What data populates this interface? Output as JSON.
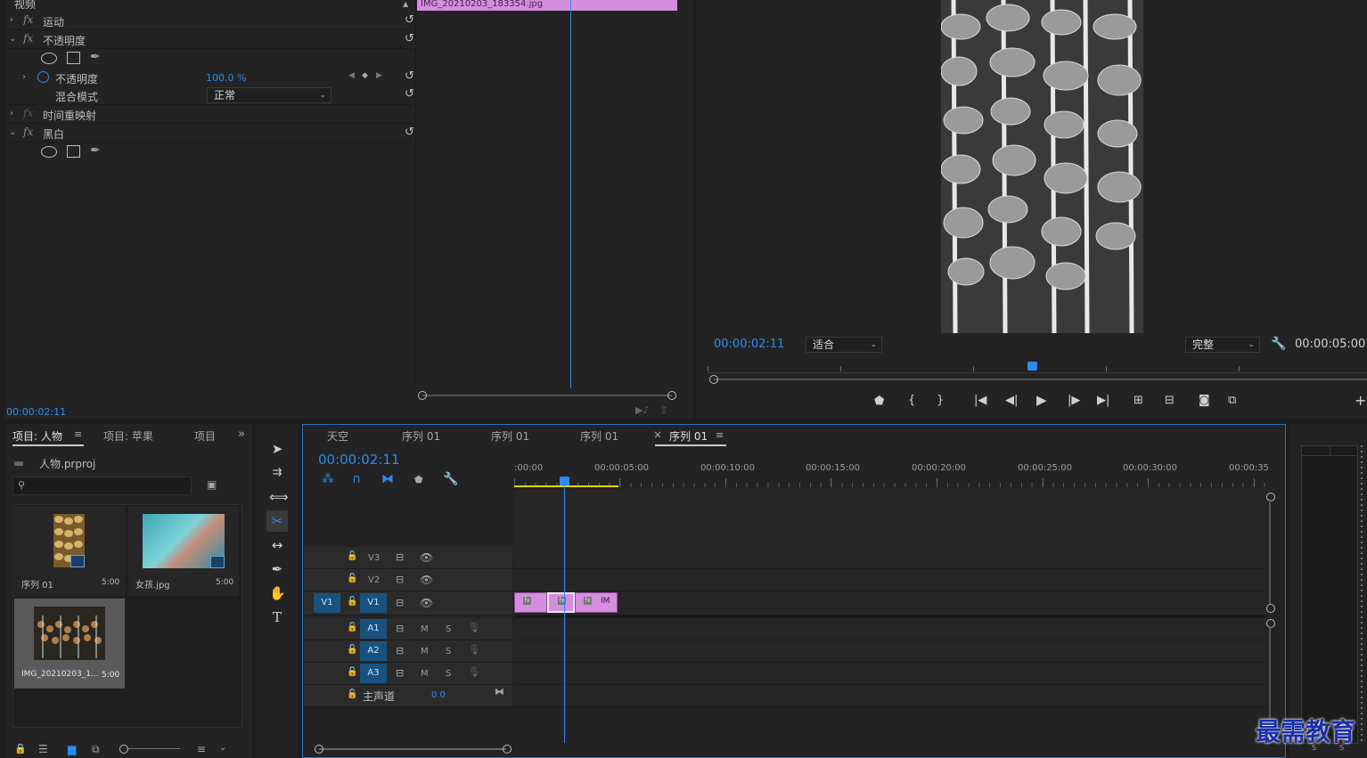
{
  "effect_controls": {
    "section_label": "视频",
    "effects": {
      "motion": "运动",
      "opacity": "不透明度",
      "opacity_param": "不透明度",
      "opacity_value": "100.0 %",
      "blend_mode_label": "混合模式",
      "blend_mode_value": "正常",
      "time_remap": "时间重映射",
      "black_white": "黑白"
    },
    "fx_label": "fx",
    "clip_name": "IMG_20210203_183354.jpg",
    "timecode": "00:00:02:11"
  },
  "program_monitor": {
    "timecode": "00:00:02:11",
    "fit_value": "适合",
    "quality_value": "完整",
    "duration": "00:00:05:00",
    "add_label": "+"
  },
  "project_panel": {
    "tabs": [
      "项目: 人物",
      "项目: 苹果",
      "项目"
    ],
    "project_file": "人物.prproj",
    "search_placeholder": "",
    "items": [
      {
        "name": "序列 01",
        "duration": "5:00"
      },
      {
        "name": "女孩.jpg",
        "duration": "5:00"
      },
      {
        "name": "IMG_20210203_1...",
        "duration": "5:00"
      }
    ]
  },
  "timeline": {
    "tabs": [
      "天空",
      "序列 01",
      "序列 01",
      "序列 01",
      "序列 01"
    ],
    "close_glyph": "×",
    "timecode": "00:00:02:11",
    "ruler": [
      ":00:00",
      "00:00:05:00",
      "00:00:10:00",
      "00:00:15:00",
      "00:00:20:00",
      "00:00:25:00",
      "00:00:30:00",
      "00:00:35"
    ],
    "video_tracks": [
      "V3",
      "V2",
      "V1"
    ],
    "source_patch": "V1",
    "audio_tracks": [
      "A1",
      "A2",
      "A3"
    ],
    "mute_label": "M",
    "solo_label": "S",
    "master_label": "主声道",
    "master_value": "0.0",
    "clip_label": "IM"
  },
  "meter": {
    "solo_labels": [
      "S",
      "S"
    ]
  },
  "watermark": "最需教育",
  "colors": {
    "accent": "#2d8ceb",
    "clip": "#d58de0",
    "playhead": "#2d8ceb",
    "workarea": "#e6d600"
  }
}
